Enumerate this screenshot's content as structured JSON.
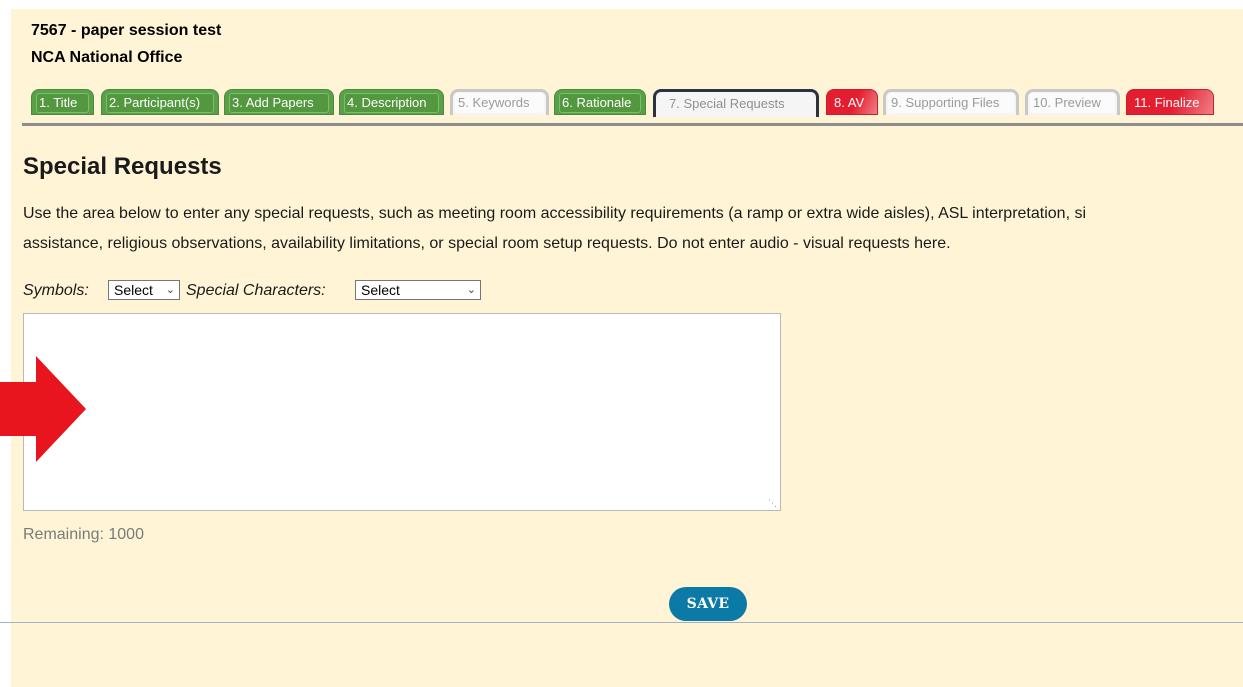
{
  "header": {
    "session_title": "7567 - paper session test",
    "organization": "NCA National Office"
  },
  "tabs": [
    {
      "label": "1. Title",
      "state": "complete"
    },
    {
      "label": "2. Participant(s)",
      "state": "complete"
    },
    {
      "label": "3. Add Papers",
      "state": "complete"
    },
    {
      "label": "4. Description",
      "state": "complete"
    },
    {
      "label": "5. Keywords",
      "state": "incomplete"
    },
    {
      "label": "6. Rationale",
      "state": "complete"
    },
    {
      "label": "7. Special Requests",
      "state": "active"
    },
    {
      "label": "8. AV",
      "state": "error"
    },
    {
      "label": "9. Supporting Files",
      "state": "incomplete"
    },
    {
      "label": "10. Preview",
      "state": "incomplete"
    },
    {
      "label": "11. Finalize",
      "state": "error"
    }
  ],
  "main": {
    "heading": "Special Requests",
    "instructions_line1": "Use the area below to enter any special requests, such as meeting room accessibility requirements (a ramp or extra wide aisles), ASL interpretation, si",
    "instructions_line2": "assistance, religious observations, availability limitations, or special room setup requests. Do not enter audio - visual requests here.",
    "symbols_label": "Symbols:",
    "symbols_value": "Select",
    "special_chars_label": "Special Characters:",
    "special_chars_value": "Select",
    "textarea_value": "",
    "remaining_label": "Remaining: 1000",
    "save_label": "SAVE"
  },
  "colors": {
    "page_background": "#fff5d6",
    "tab_complete": "#5aa04a",
    "tab_error": "#e32c3c",
    "save_button": "#0c7aa6",
    "annotation_arrow": "#e8141e"
  },
  "icons": {
    "dropdown": "chevron-down-icon",
    "annotation": "red-arrow-icon",
    "textarea_resize": "resize-grip-icon"
  }
}
